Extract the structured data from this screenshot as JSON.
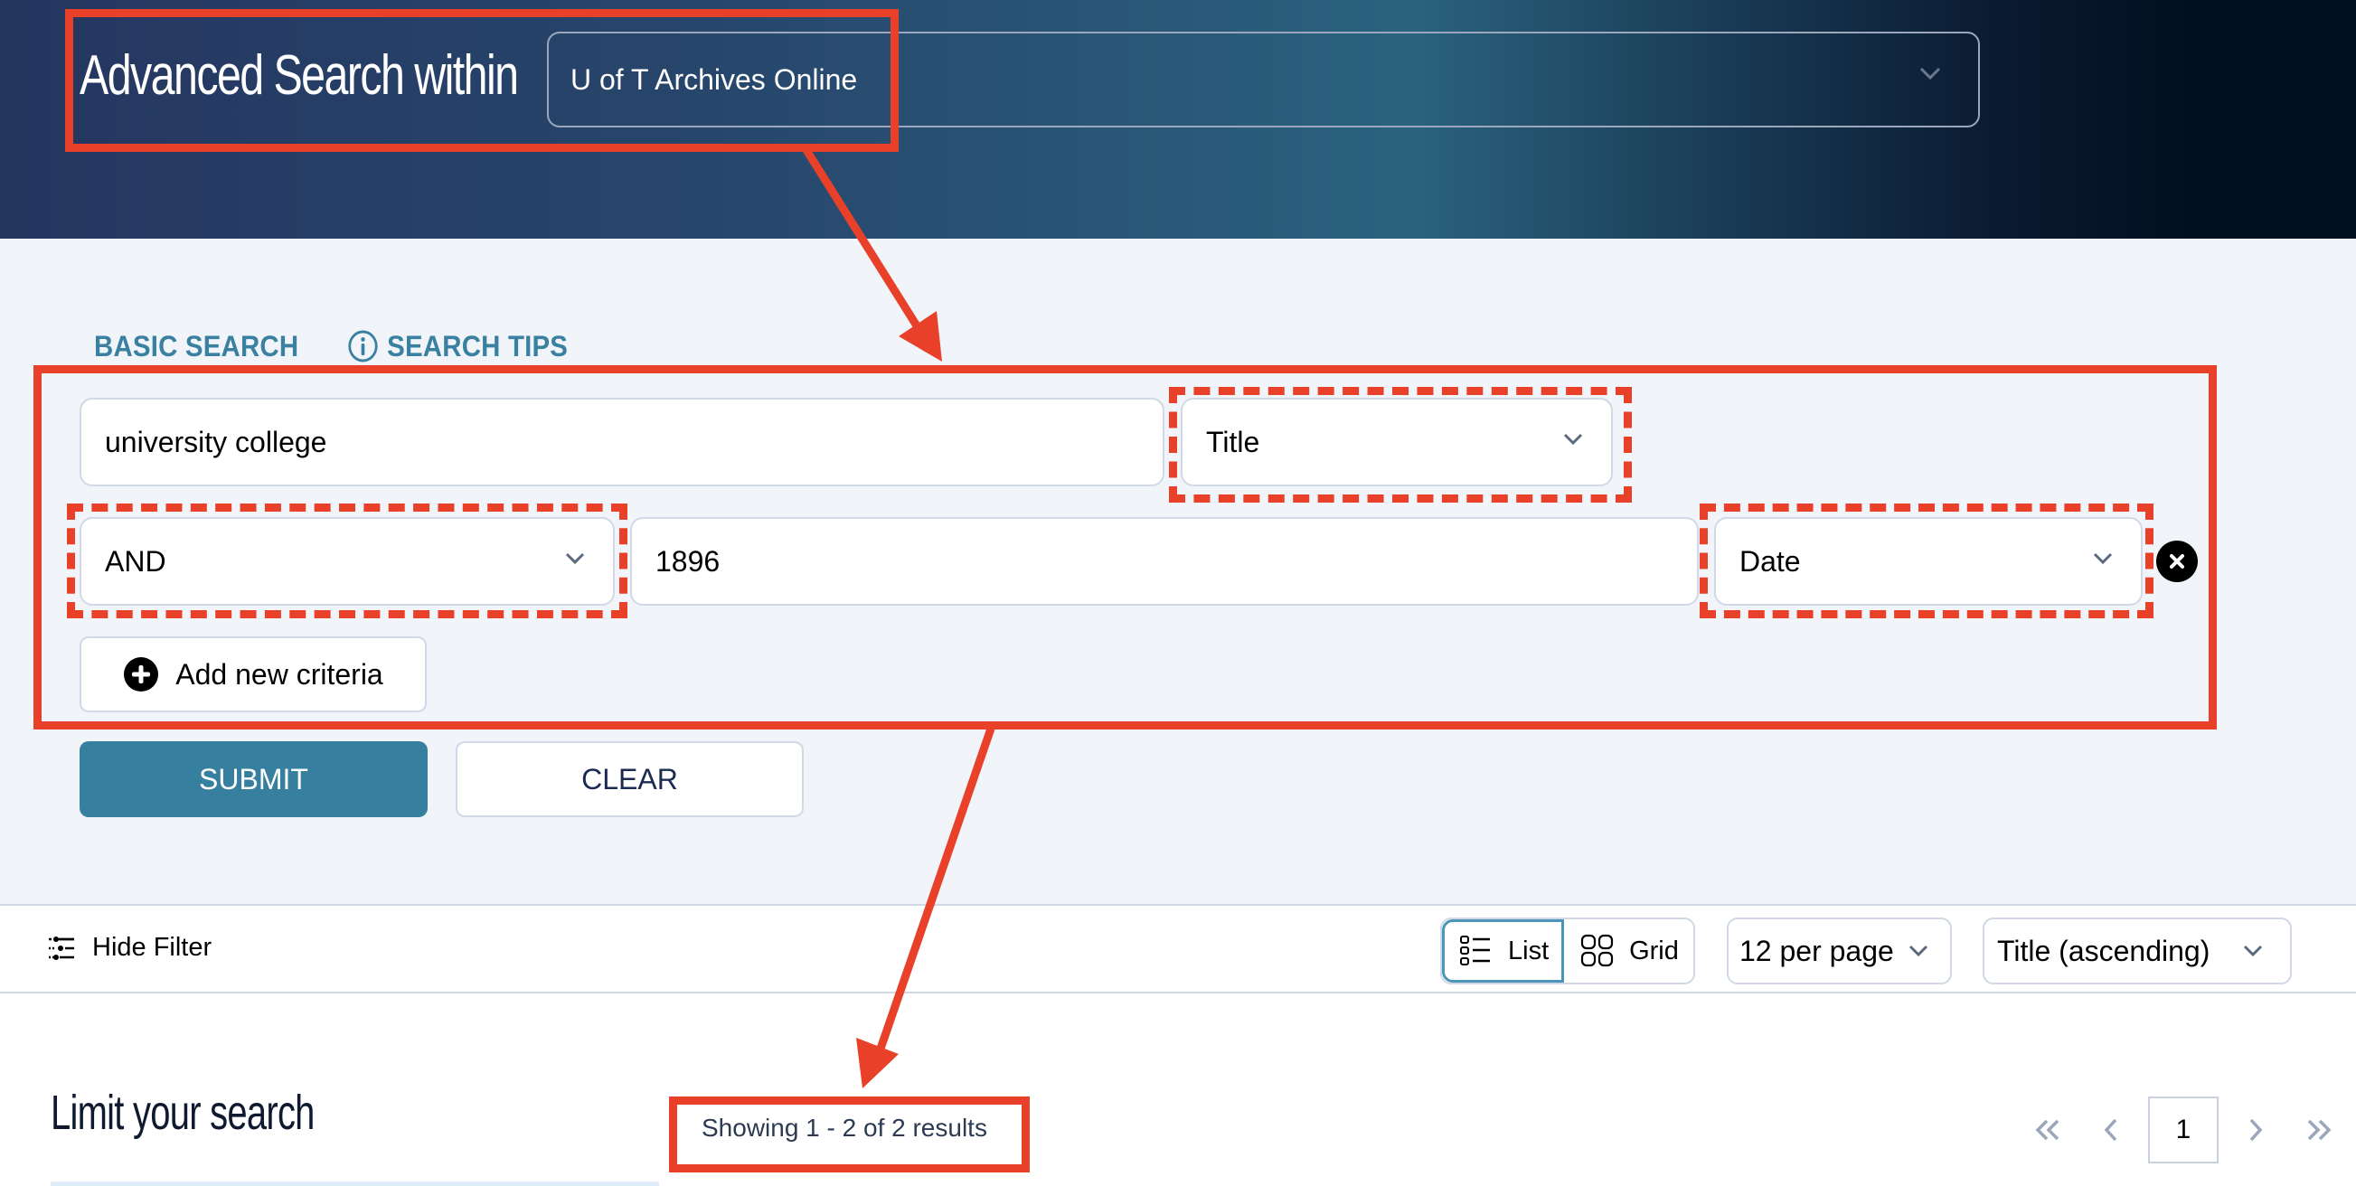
{
  "header": {
    "title": "Advanced Search within",
    "scope_select": {
      "value": "U of T Archives Online",
      "icon": "chevron-down-icon"
    }
  },
  "search_links": {
    "basic_search": "BASIC SEARCH",
    "search_tips": "SEARCH TIPS",
    "search_tips_icon": "info-circle-icon"
  },
  "criteria": [
    {
      "operator": null,
      "query": "university college",
      "field": "Title",
      "removable": false
    },
    {
      "operator": "AND",
      "query": "1896",
      "field": "Date",
      "removable": true
    }
  ],
  "buttons": {
    "add_criteria": "Add new criteria",
    "add_icon": "plus-circle-icon",
    "remove_icon": "close-circle-icon",
    "submit": "SUBMIT",
    "clear": "CLEAR"
  },
  "toolbar": {
    "hide_filter": "Hide Filter",
    "hide_filter_icon": "sliders-icon",
    "view_options": [
      {
        "label": "List",
        "icon": "list-icon",
        "active": true
      },
      {
        "label": "Grid",
        "icon": "grid-icon",
        "active": false
      }
    ],
    "per_page": "12 per page",
    "sort": "Title (ascending)"
  },
  "results": {
    "sidebar_title": "Limit your search",
    "showing_text": "Showing 1 - 2 of 2 results",
    "pagination": {
      "first_icon": "double-chevron-left-icon",
      "prev_icon": "chevron-left-icon",
      "current_page": "1",
      "next_icon": "chevron-right-icon",
      "last_icon": "double-chevron-right-icon"
    }
  },
  "colors": {
    "annotation": "#e94129",
    "accent": "#377f9f",
    "link": "#3a80a1",
    "header_start": "#25365f",
    "header_mid": "#2a627e",
    "header_end": "#020f20",
    "page_bg": "#f1f5fa"
  }
}
